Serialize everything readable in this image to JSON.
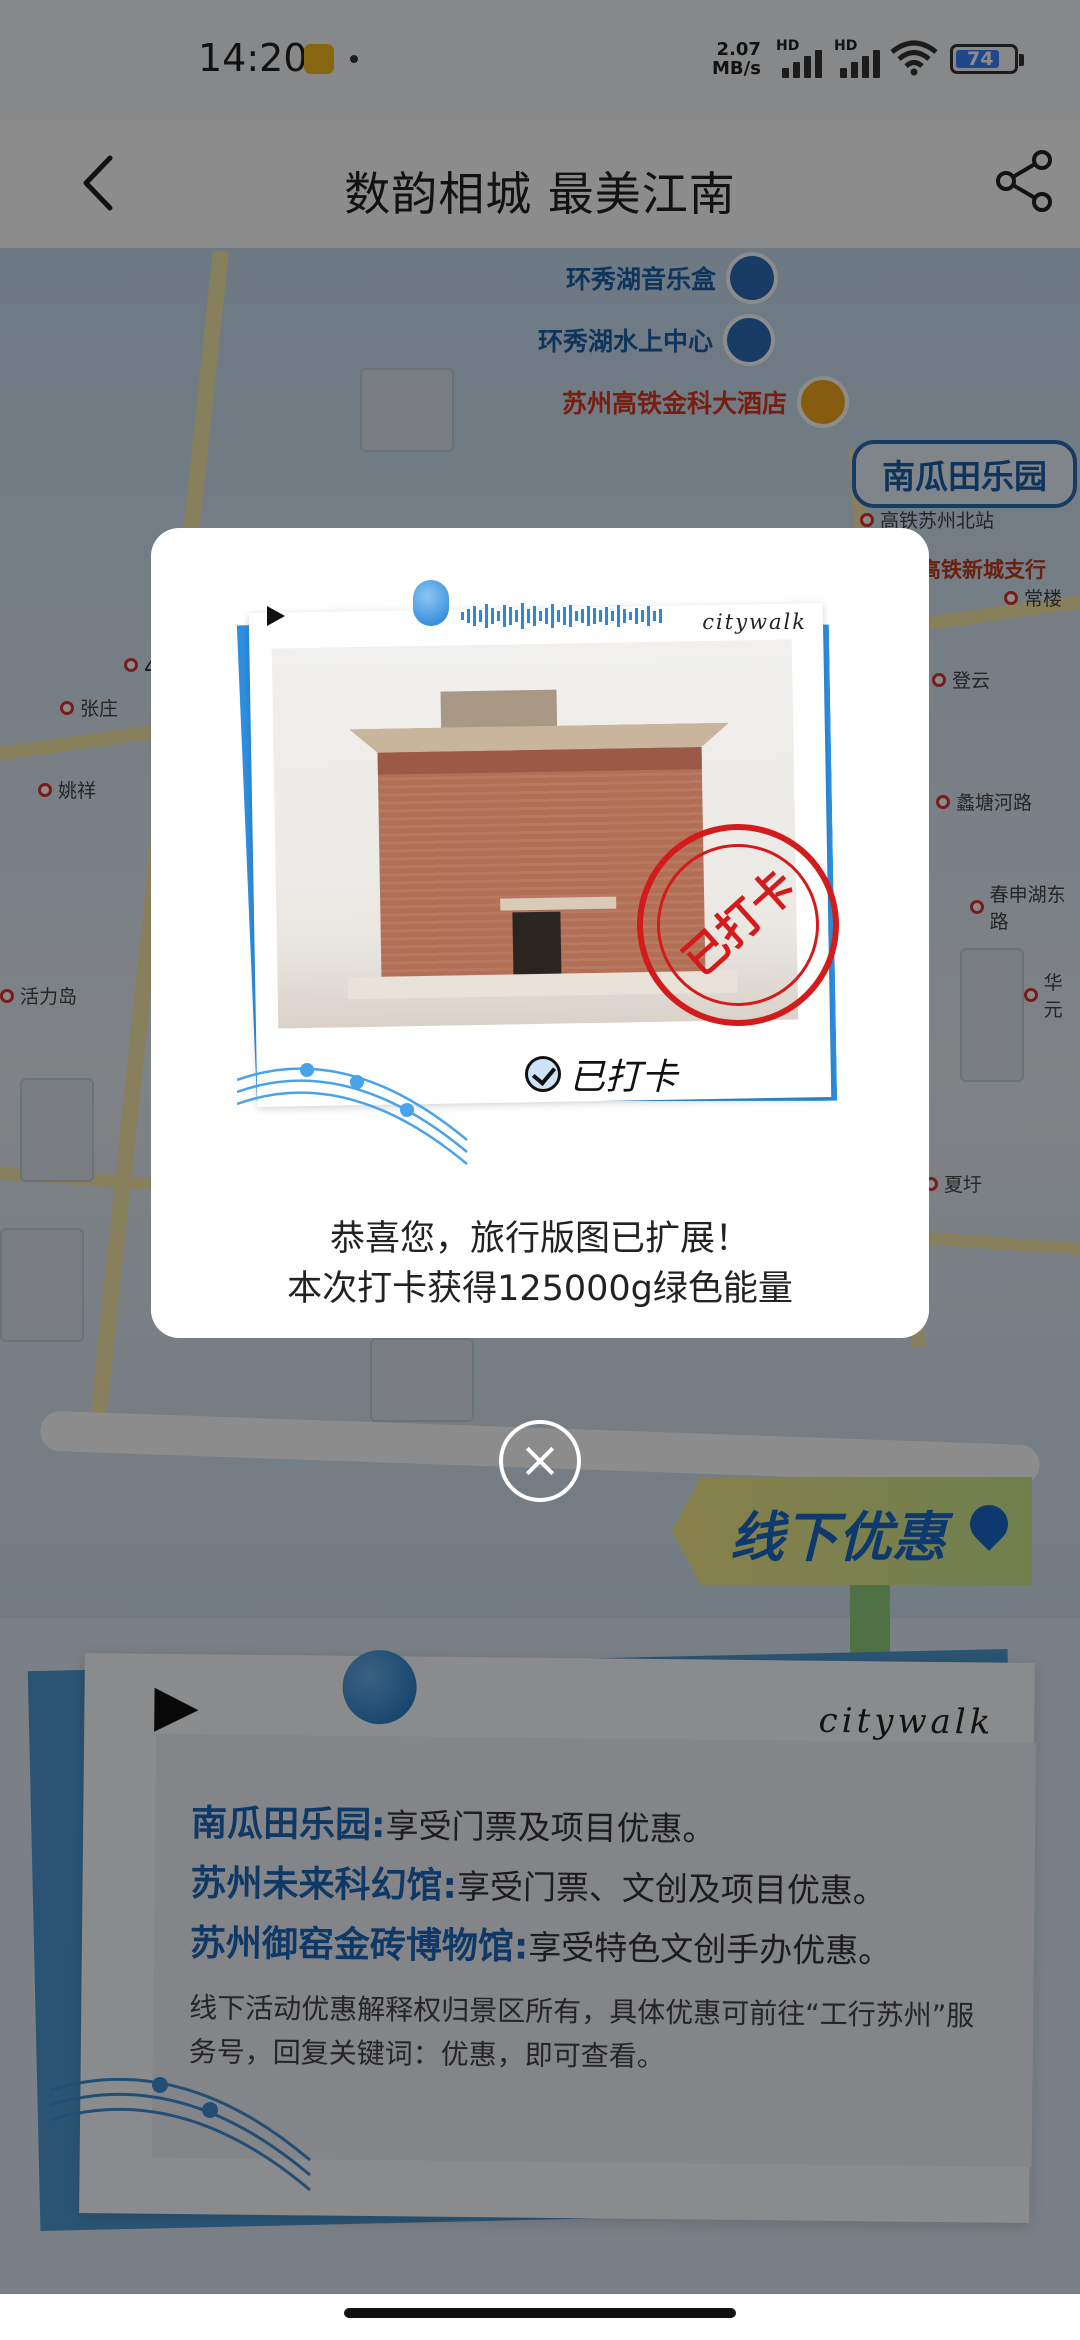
{
  "status_bar": {
    "time": "14:20",
    "net_speed_value": "2.07",
    "net_speed_unit": "MB/s",
    "sim1": "HD",
    "sim2": "HD",
    "battery": "74"
  },
  "nav": {
    "title": "数韵相城 最美江南",
    "back_icon": "chevron-left-icon",
    "share_icon": "share-icon"
  },
  "map": {
    "pois": [
      {
        "label": "环秀湖音乐盒"
      },
      {
        "label": "环秀湖水上中心"
      },
      {
        "label": "苏州高铁金科大酒店"
      }
    ],
    "park_label": "南瓜田乐园",
    "bank_label": "高铁新城支行",
    "stations": [
      "张庄",
      "姚祥",
      "活力岛",
      "高铁苏州北站",
      "常楼",
      "登云",
      "蠡塘河路",
      "春申湖东路",
      "华元",
      "夏圩"
    ],
    "line_label": "4号"
  },
  "offline_sign": "线下优惠",
  "offer_card": {
    "brand": "citywalk",
    "items": [
      {
        "name": "南瓜田乐园:",
        "desc": "享受门票及项目优惠。"
      },
      {
        "name": "苏州未来科幻馆:",
        "desc": "享受门票、文创及项目优惠。"
      },
      {
        "name": "苏州御窑金砖博物馆:",
        "desc": "享受特色文创手办优惠。"
      }
    ],
    "note": "线下活动优惠解释权归景区所有，具体优惠可前往“工行苏州”服务号，回复关键词：优惠，即可查看。"
  },
  "modal": {
    "photo_brand": "citywalk",
    "stamp_text": "已打卡",
    "check_label": "已打卡",
    "line1": "恭喜您，旅行版图已扩展！",
    "line2": "本次打卡获得125000g绿色能量"
  },
  "close_icon": "close-circle-icon",
  "colors": {
    "accent_blue": "#1a66b8",
    "stamp_red": "#d31b1b",
    "overlay": "rgba(0,0,0,0.45)"
  }
}
